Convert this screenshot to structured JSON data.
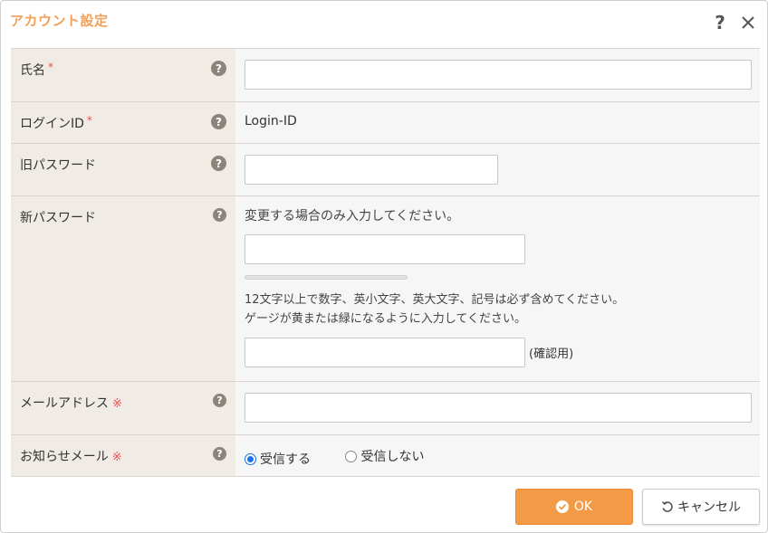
{
  "dialog": {
    "title": "アカウント設定",
    "help_glyph": "?",
    "accent_color": "#f0a057"
  },
  "fields": {
    "name": {
      "label": "氏名",
      "required_mark": "*",
      "value": ""
    },
    "login_id": {
      "label": "ログインID",
      "required_mark": "*",
      "value": "Login-ID"
    },
    "old_password": {
      "label": "旧パスワード",
      "value": ""
    },
    "new_password": {
      "label": "新パスワード",
      "instruction": "変更する場合のみ入力してください。",
      "value": "",
      "strength_level": 0,
      "hint_line1": "12文字以上で数字、英小文字、英大文字、記号は必ず含めてください。",
      "hint_line2": "ゲージが黄または緑になるように入力してください。",
      "confirm_value": "",
      "confirm_label": "(確認用)"
    },
    "email": {
      "label": "メールアドレス",
      "required_mark": "※",
      "value": ""
    },
    "notification": {
      "label": "お知らせメール",
      "required_mark": "※",
      "options": [
        "受信する",
        "受信しない"
      ],
      "selected": "受信する"
    }
  },
  "buttons": {
    "ok_label": "OK",
    "cancel_label": "キャンセル"
  },
  "icons": {
    "help": "help-icon",
    "close": "close-icon",
    "check": "check-circle-icon",
    "undo": "undo-icon"
  },
  "colors": {
    "ok_button": "#f39a47",
    "required": "#e8534a",
    "label_bg": "#f0ebe4"
  }
}
